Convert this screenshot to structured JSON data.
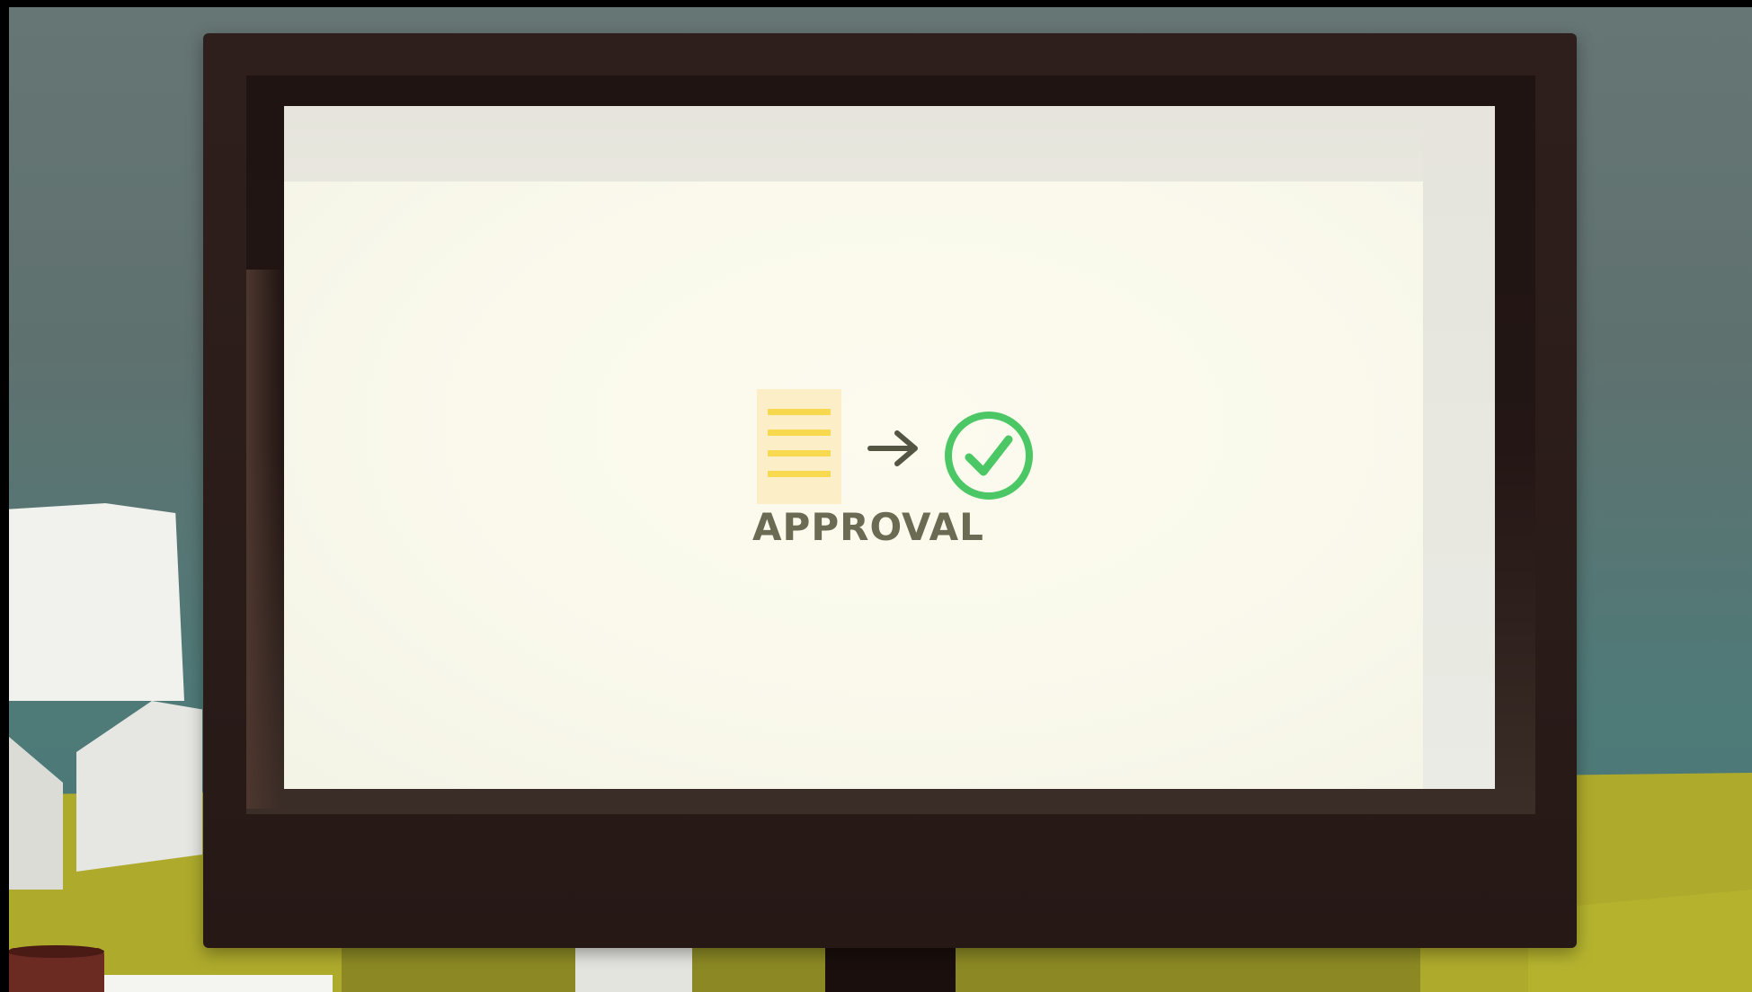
{
  "scene": {
    "screen_label": "APPROVAL",
    "icons": {
      "document": "document-icon",
      "arrow": "arrow-right-icon",
      "check": "checkmark-circle-icon"
    },
    "colors": {
      "label": "#6b6a52",
      "document_bg": "#fcefc8",
      "document_lines": "#f7d84f",
      "check": "#4cc765",
      "arrow": "#555544",
      "monitor": "#2c1d1a",
      "floor": "#aeaa2c"
    }
  }
}
